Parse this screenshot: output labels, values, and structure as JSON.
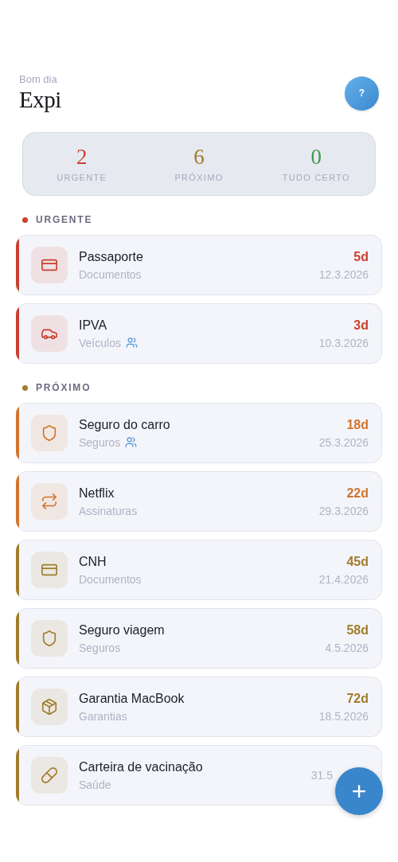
{
  "header": {
    "greeting": "Bom dia",
    "title": "Expi",
    "help_button": "?"
  },
  "summary": [
    {
      "count": "2",
      "label": "URGENTE",
      "color": "#c8402f"
    },
    {
      "count": "6",
      "label": "PRÓXIMO",
      "color": "#a07d2c"
    },
    {
      "count": "0",
      "label": "TUDO CERTO",
      "color": "#3f9a4a"
    }
  ],
  "sections": [
    {
      "title": "URGENTE",
      "color": "#c8402f",
      "items": [
        {
          "name": "Passaporte",
          "category": "Documentos",
          "kind": "card",
          "shared": false,
          "days": "5d",
          "date": "12.3.2026",
          "color": "#c8402f"
        },
        {
          "name": "IPVA",
          "category": "Veículos",
          "kind": "car",
          "shared": true,
          "days": "3d",
          "date": "10.3.2026",
          "color": "#c8402f"
        }
      ]
    },
    {
      "title": "PRÓXIMO",
      "color": "#a07d2c",
      "items": [
        {
          "name": "Seguro do carro",
          "category": "Seguros",
          "kind": "shield",
          "shared": true,
          "days": "18d",
          "date": "25.3.2026",
          "color": "#d2752c"
        },
        {
          "name": "Netflix",
          "category": "Assinaturas",
          "kind": "repeat",
          "shared": false,
          "days": "22d",
          "date": "29.3.2026",
          "color": "#d2752c"
        },
        {
          "name": "CNH",
          "category": "Documentos",
          "kind": "card",
          "shared": false,
          "days": "45d",
          "date": "21.4.2026",
          "color": "#a07d2c"
        },
        {
          "name": "Seguro viagem",
          "category": "Seguros",
          "kind": "shield",
          "shared": false,
          "days": "58d",
          "date": "4.5.2026",
          "color": "#a07d2c"
        },
        {
          "name": "Garantia MacBook",
          "category": "Garantias",
          "kind": "box",
          "shared": false,
          "days": "72d",
          "date": "18.5.2026",
          "color": "#a07d2c"
        },
        {
          "name": "Carteira de vacinação",
          "category": "Saúde",
          "kind": "pill",
          "shared": false,
          "date": "31.5",
          "color": "#a07d2c"
        }
      ]
    }
  ],
  "fab": "+"
}
